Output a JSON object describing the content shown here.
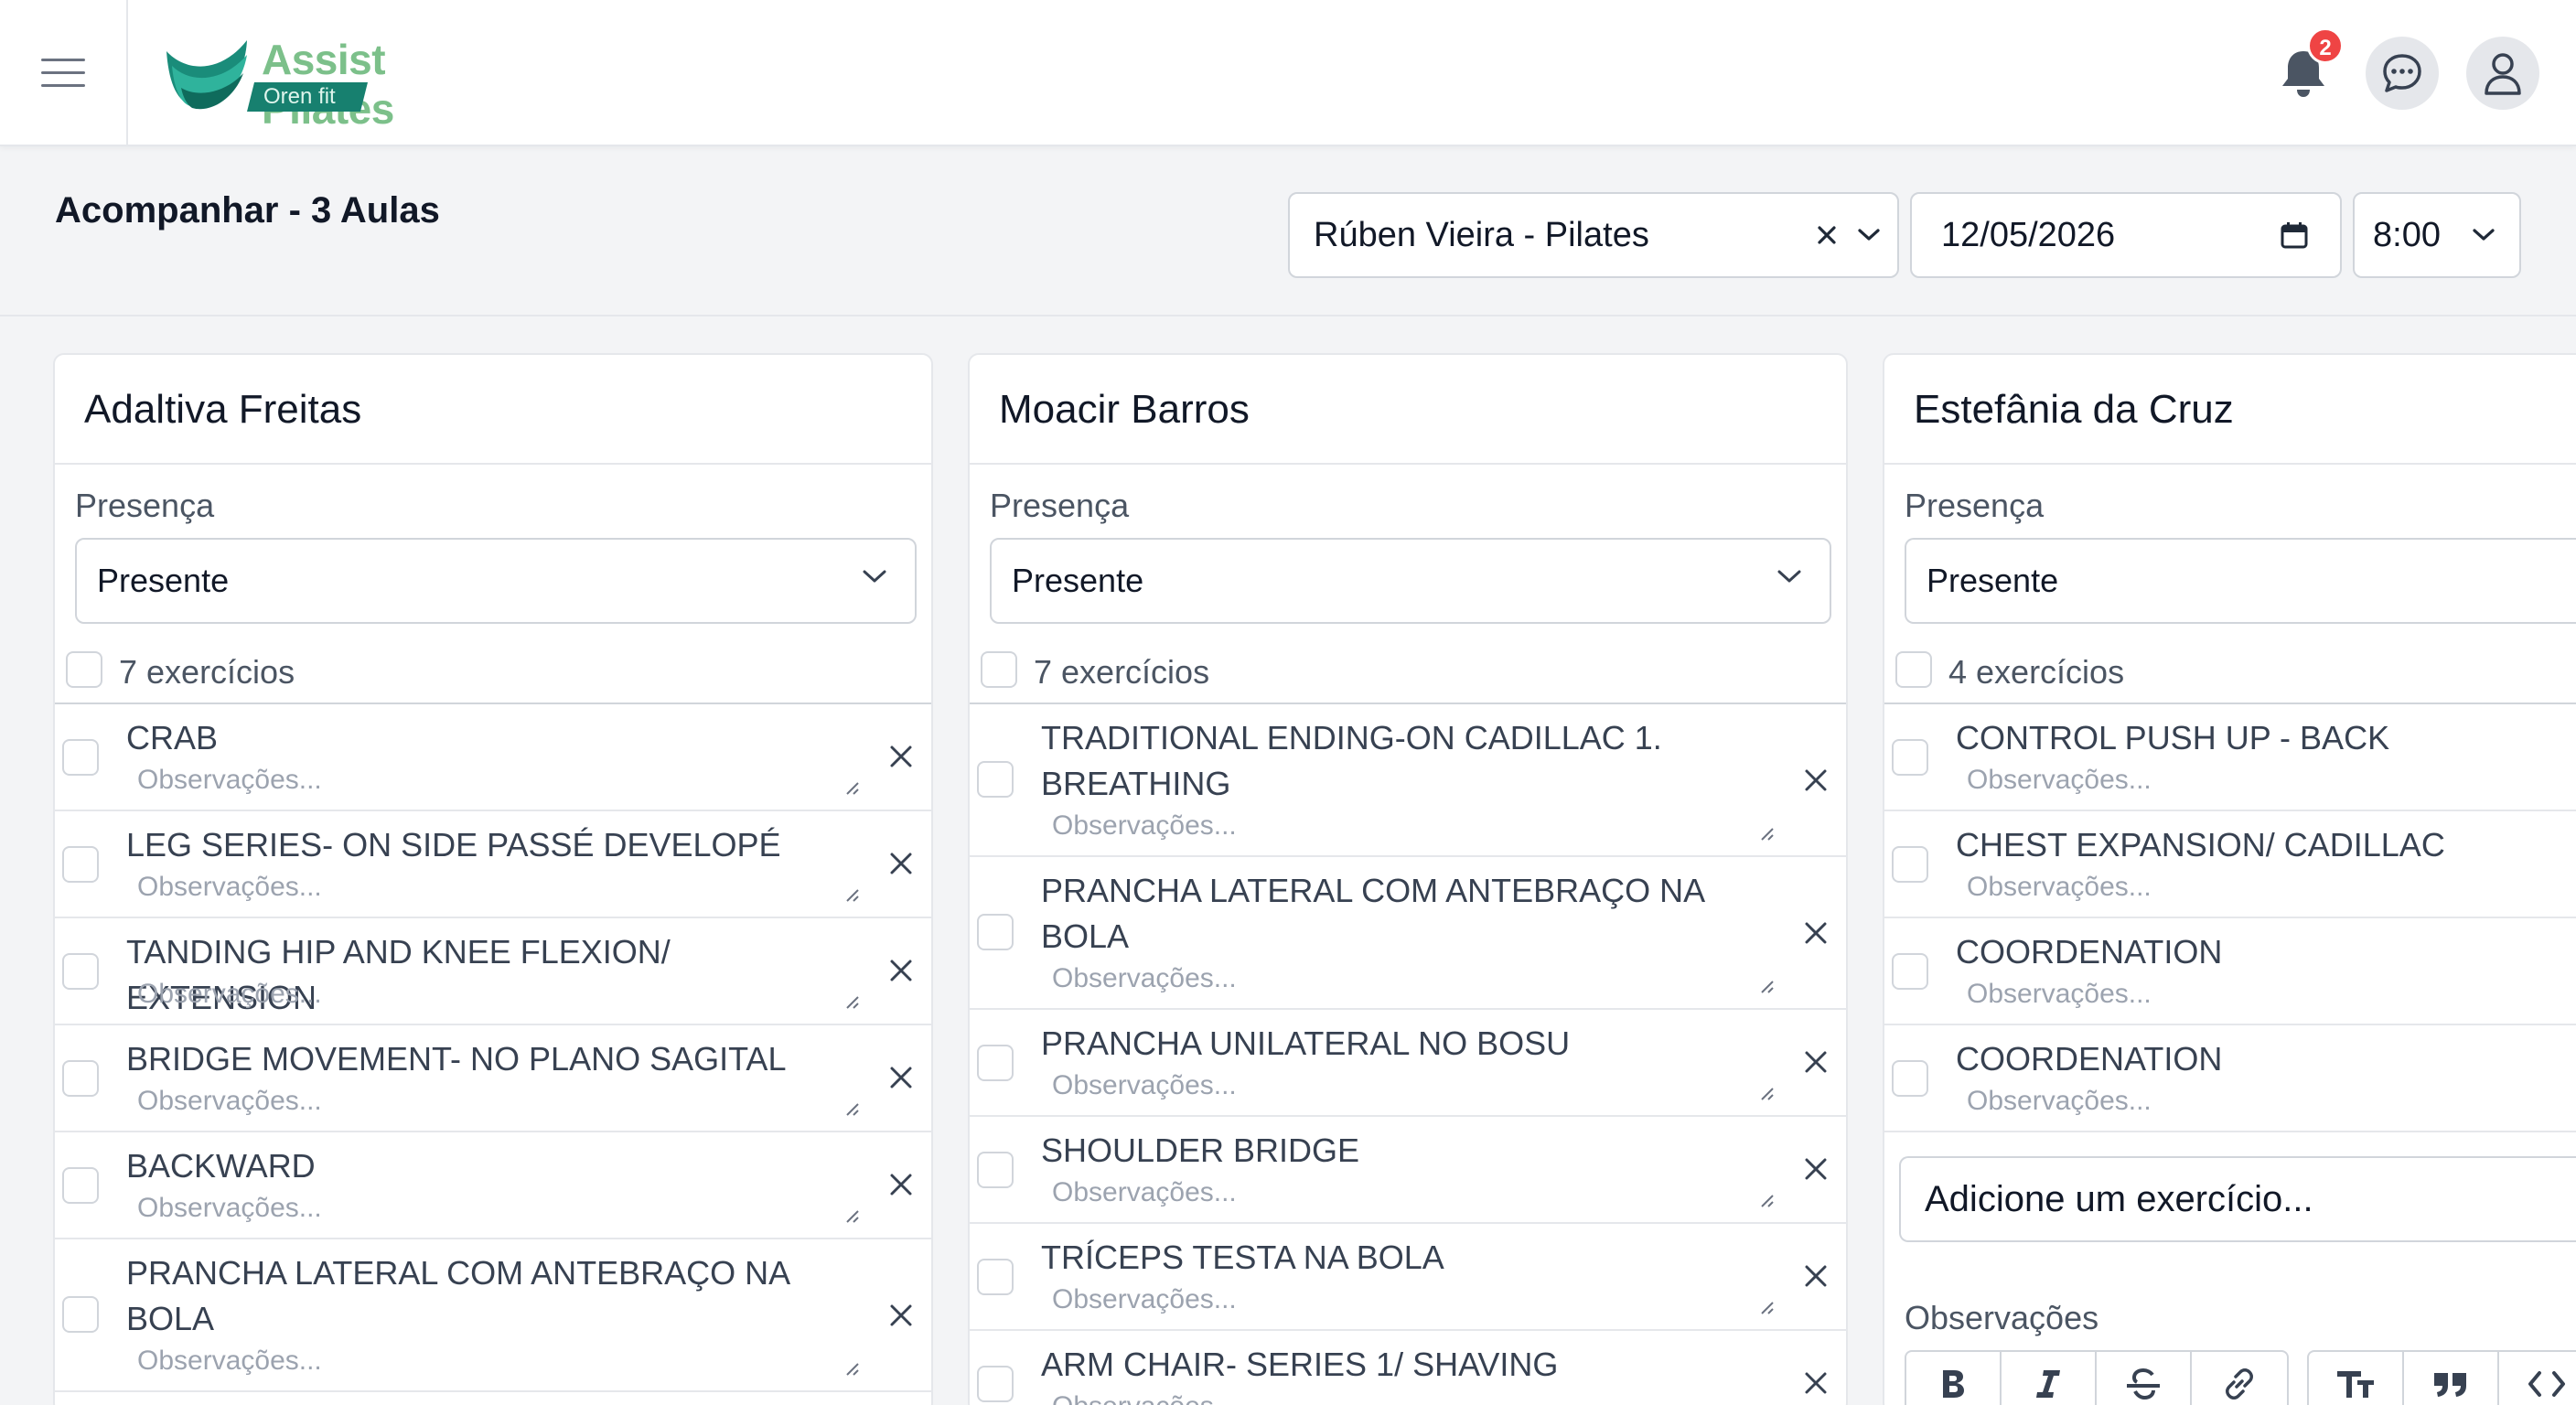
{
  "brand": {
    "name": "Assist Pilates",
    "sub": "Oren fit",
    "colors": {
      "primary": "#7cc08a",
      "secondary": "#17806f"
    }
  },
  "header": {
    "notification_count": "2",
    "icons": [
      "menu-icon",
      "bell-icon",
      "chat-icon",
      "user-icon"
    ]
  },
  "page": {
    "title": "Acompanhar - 3 Aulas",
    "instructor": "Rúben Vieira - Pilates",
    "date": "12/05/2026",
    "time": "8:00"
  },
  "cards": [
    {
      "student": "Adaltiva Freitas",
      "presence_label": "Presença",
      "presence": "Presente",
      "exercise_count": "7 exercícios",
      "exercises": [
        {
          "name": "CRAB",
          "placeholder": "Observações..."
        },
        {
          "name": "LEG SERIES- ON SIDE PASSÉ DEVELOPÉ",
          "placeholder": "Observações..."
        },
        {
          "name": "TANDING HIP AND KNEE FLEXION/ EXTENSION",
          "placeholder": "Observações..."
        },
        {
          "name": "BRIDGE MOVEMENT- NO PLANO SAGITAL",
          "placeholder": "Observações..."
        },
        {
          "name": "BACKWARD",
          "placeholder": "Observações..."
        },
        {
          "name": "PRANCHA LATERAL COM ANTEBRAÇO NA BOLA",
          "placeholder": "Observações..."
        }
      ]
    },
    {
      "student": "Moacir Barros",
      "presence_label": "Presença",
      "presence": "Presente",
      "exercise_count": "7 exercícios",
      "exercises": [
        {
          "name": "TRADITIONAL ENDING-ON CADILLAC 1. BREATHING",
          "placeholder": "Observações..."
        },
        {
          "name": "PRANCHA LATERAL COM ANTEBRAÇO NA BOLA",
          "placeholder": "Observações..."
        },
        {
          "name": "PRANCHA UNILATERAL NO BOSU",
          "placeholder": "Observações..."
        },
        {
          "name": "SHOULDER BRIDGE",
          "placeholder": "Observações..."
        },
        {
          "name": "TRÍCEPS TESTA NA BOLA",
          "placeholder": "Observações..."
        },
        {
          "name": "ARM CHAIR- SERIES 1/ SHAVING",
          "placeholder": "Observações..."
        }
      ]
    },
    {
      "student": "Estefânia da Cruz",
      "presence_label": "Presença",
      "presence": "Presente",
      "exercise_count": "4 exercícios",
      "exercises": [
        {
          "name": "CONTROL PUSH UP - BACK",
          "placeholder": "Observações..."
        },
        {
          "name": "CHEST EXPANSION/ CADILLAC",
          "placeholder": "Observações..."
        },
        {
          "name": "COORDENATION",
          "placeholder": "Observações..."
        },
        {
          "name": "COORDENATION",
          "placeholder": "Observações..."
        }
      ],
      "add_exercise_placeholder": "Adicione um exercício...",
      "notes_label": "Observações",
      "toolbar": [
        "bold-icon",
        "italic-icon",
        "strikethrough-icon",
        "link-icon",
        "heading-icon",
        "quote-icon",
        "code-icon"
      ]
    }
  ]
}
